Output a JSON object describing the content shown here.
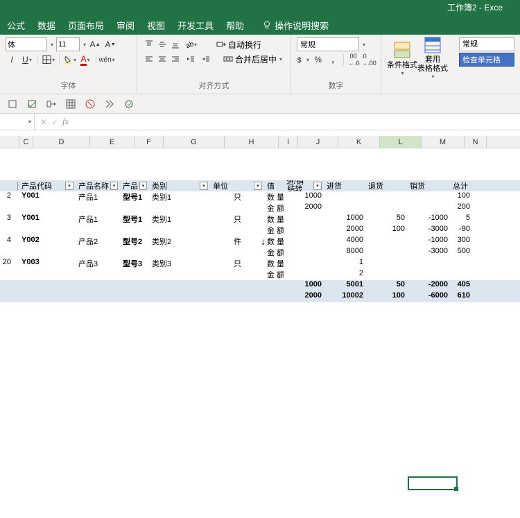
{
  "title": "工作簿2 - Exce",
  "menu": {
    "formulas": "公式",
    "data": "数据",
    "page_layout": "页面布局",
    "review": "审阅",
    "view": "视图",
    "dev_tools": "开发工具",
    "help": "帮助",
    "tell_me": "操作说明搜索"
  },
  "ribbon": {
    "font_label": "字体",
    "font_name": "体",
    "font_size": "11",
    "align_label": "对齐方式",
    "wrap_text": "自动换行",
    "merge_center": "合并后居中",
    "number_label": "数字",
    "num_format": "常规",
    "cond_fmt": "条件格式",
    "table_fmt": "套用\n表格格式",
    "style_normal": "常规",
    "style_check": "检查单元格"
  },
  "columns": [
    "",
    "C",
    "D",
    "E",
    "F",
    "G",
    "H",
    "I",
    "J",
    "K",
    "L",
    "M",
    "N"
  ],
  "headers": {
    "blank": "",
    "code": "产品代码",
    "name": "产品名称",
    "model": "产品",
    "category": "类别",
    "unit": "单位",
    "value": "值",
    "carry_over": "进/销\n结转",
    "purchase": "进货",
    "return": "退货",
    "sales": "销货",
    "total": "总计"
  },
  "rows": [
    {
      "idx": "2",
      "code": "Y001",
      "name": "产品1",
      "model": "型号1",
      "category": "类别1",
      "unit": "只",
      "v1": "数 量",
      "v2": "金 额",
      "carry": [
        "1000",
        "2000"
      ],
      "purchase": [
        "",
        ""
      ],
      "ret": [
        "",
        ""
      ],
      "sales": [
        "",
        ""
      ],
      "total": [
        "100",
        "200"
      ]
    },
    {
      "idx": "3",
      "code": "Y001",
      "name": "产品1",
      "model": "型号1",
      "category": "类别1",
      "unit": "只",
      "v1": "数 量",
      "v2": "金 额",
      "carry": [
        "",
        ""
      ],
      "purchase": [
        "1000",
        "2000"
      ],
      "ret": [
        "50",
        "100"
      ],
      "sales": [
        "-1000",
        "-3000"
      ],
      "total": [
        "5",
        "-90"
      ]
    },
    {
      "idx": "4",
      "code": "Y002",
      "name": "产品2",
      "model": "型号2",
      "category": "类别2",
      "unit": "件",
      "v1": "数 量",
      "v2": "金 额",
      "carry": [
        "",
        ""
      ],
      "purchase": [
        "4000",
        "8000"
      ],
      "ret": [
        "",
        ""
      ],
      "sales": [
        "-1000",
        "-3000"
      ],
      "total": [
        "300",
        "500"
      ]
    },
    {
      "idx": "20",
      "code": "Y003",
      "name": "产品3",
      "model": "型号3",
      "category": "类别3",
      "unit": "只",
      "v1": "数 量",
      "v2": "金 额",
      "carry": [
        "",
        ""
      ],
      "purchase": [
        "1",
        "2"
      ],
      "ret": [
        "",
        ""
      ],
      "sales": [
        "",
        ""
      ],
      "total": [
        "",
        ""
      ]
    }
  ],
  "totals": {
    "r1": {
      "carry": "1000",
      "purchase": "5001",
      "ret": "50",
      "sales": "-2000",
      "total": "405"
    },
    "r2": {
      "carry": "2000",
      "purchase": "10002",
      "ret": "100",
      "sales": "-6000",
      "total": "610"
    }
  }
}
